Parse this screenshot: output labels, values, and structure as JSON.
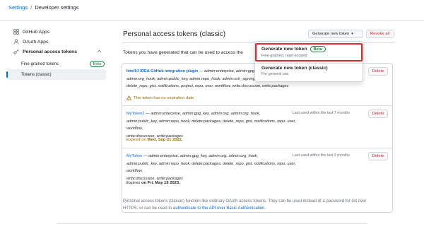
{
  "breadcrumb": {
    "root": "Settings",
    "sep": "/",
    "current": "Developer settings"
  },
  "sidebar": {
    "items": [
      {
        "label": "GitHub Apps",
        "icon": "apps-grid-icon"
      },
      {
        "label": "OAuth Apps",
        "icon": "person-icon"
      },
      {
        "label": "Personal access tokens",
        "icon": "key-icon"
      }
    ],
    "sub_items": [
      {
        "label": "Fine-grained tokens",
        "badge": "Beta"
      },
      {
        "label": "Tokens (classic)"
      }
    ]
  },
  "main": {
    "title": "Personal access tokens (classic)",
    "generate_button": "Generate new token",
    "revoke_button": "Revoke all",
    "intro": "Tokens you have generated that can be used to access the",
    "tokens": [
      {
        "name": "IntelliJ IDEA GitHub integration plugin",
        "scopes_l1": " — admin:enterprise, admin:gpg_key, admin:org,",
        "scopes_l2": "admin:org_hook, admin:public_key, admin:repo_hook, admin:ssh_signing_key, audit_log, codespace, delete:packages,",
        "scopes_l3": "delete_repo, gist, notifications, project, repo, user, workflow, write:discussion, write:packages",
        "warning": "This token has no expiration date.",
        "delete": "Delete"
      },
      {
        "name": "MyToken1",
        "scopes_l1": " — admin:enterprise, admin:gpg_key, admin:org, admin:org_hook,",
        "scopes_l2": "admin:public_key, admin:repo_hook, delete:packages, delete_repo, gist, notifications, repo, user, workflow,",
        "scopes_l3": "write:discussion, write:packages",
        "last_used": "Last used within the last 7 months",
        "expiry_prefix": "Expired on",
        "expiry_date": "Wed, Sep 21 2022.",
        "delete": "Delete"
      },
      {
        "name": "MyToken",
        "scopes_l1": " — admin:enterprise, admin:gpg_key, admin:org, admin:org_hook,",
        "scopes_l2": "admin:public_key, admin:repo_hook, delete:packages, delete_repo, gist, notifications, repo, user, workflow,",
        "scopes_l3": "write:discussion, write:packages",
        "last_used": "Last used within the last 2 months",
        "expiry_prefix": "Expires",
        "expiry_date": "on Fri, May 19 2023.",
        "delete": "Delete"
      }
    ],
    "footer_l1": "Personal access tokens (classic) function like ordinary OAuth access tokens. They can be used instead of a password for Git over",
    "footer_l2_pre": "HTTPS, or can be used to ",
    "footer_link": "authenticate to the API over Basic Authentication",
    "footer_l2_post": "."
  },
  "dropdown": {
    "items": [
      {
        "title": "Generate new token",
        "badge": "Beta",
        "desc": "Fine-grained, repo-scoped"
      },
      {
        "title": "Generate new token (classic)",
        "desc": "For general use"
      }
    ],
    "highlight_color": "#e5262b"
  },
  "colors": {
    "link": "#0969da",
    "danger": "#cf222e",
    "attention": "#9a6700",
    "success": "#1a7f37"
  }
}
